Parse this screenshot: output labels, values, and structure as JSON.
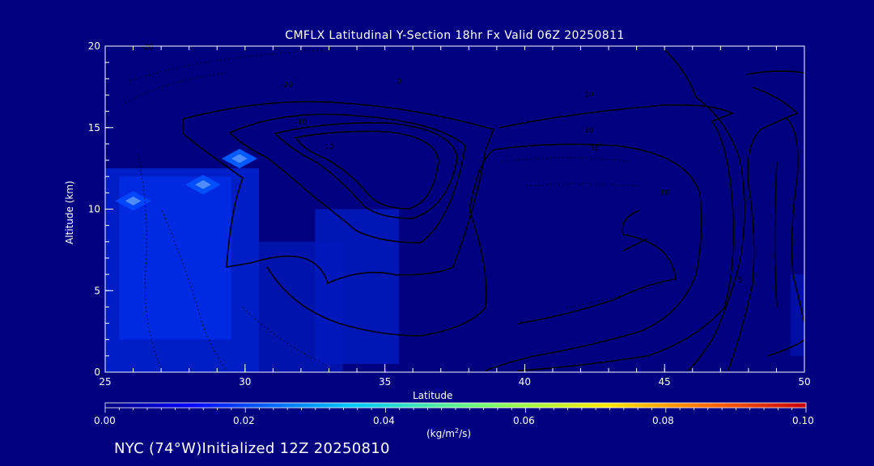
{
  "chart_data": {
    "type": "heatmap",
    "title": "CMFLX Latitudinal Y-Section 18hr  Fx Valid 06Z 20250811",
    "xlabel": "Latitude",
    "ylabel": "Altitude (km)",
    "xlim": [
      25,
      50
    ],
    "ylim": [
      0,
      20
    ],
    "xticks": [
      "25",
      "30",
      "35",
      "40",
      "45",
      "50"
    ],
    "yticks": [
      "0",
      "5",
      "10",
      "15",
      "20"
    ],
    "contour_labels": [
      "-20",
      "-20",
      "-10",
      "0",
      "10",
      "10",
      "10",
      "10",
      "10",
      "5"
    ],
    "colorbar": {
      "min": 0.0,
      "max": 0.1,
      "ticks": [
        "0.00",
        "0.02",
        "0.04",
        "0.06",
        "0.08",
        "0.10"
      ],
      "units_base": "(kg/m",
      "units_sup": "2",
      "units_tail": "/s)"
    },
    "colors": {
      "background": "#000080",
      "low": "#0022d8",
      "mid": "#0038ff",
      "high": "#2a6cff",
      "contour": "#000000"
    },
    "field_regions": [
      {
        "lat": [
          25,
          30.5
        ],
        "alt": [
          0,
          12.5
        ],
        "value": 0.008
      },
      {
        "lat": [
          25.5,
          29.5
        ],
        "alt": [
          2,
          12
        ],
        "value": 0.01
      },
      {
        "lat": [
          30.5,
          33.5
        ],
        "alt": [
          0,
          8
        ],
        "value": 0.005
      },
      {
        "lat": [
          32.5,
          35.5
        ],
        "alt": [
          0.5,
          10
        ],
        "value": 0.006
      },
      {
        "lat": [
          49.5,
          50
        ],
        "alt": [
          1,
          6
        ],
        "value": 0.004
      }
    ],
    "hotspots": [
      {
        "lat": 26,
        "alt": 10.5,
        "value": 0.016
      },
      {
        "lat": 28.5,
        "alt": 11.5,
        "value": 0.018
      },
      {
        "lat": 29.8,
        "alt": 13.1,
        "value": 0.02
      }
    ]
  },
  "footer": "NYC (74°W)Initialized 12Z 20250810"
}
